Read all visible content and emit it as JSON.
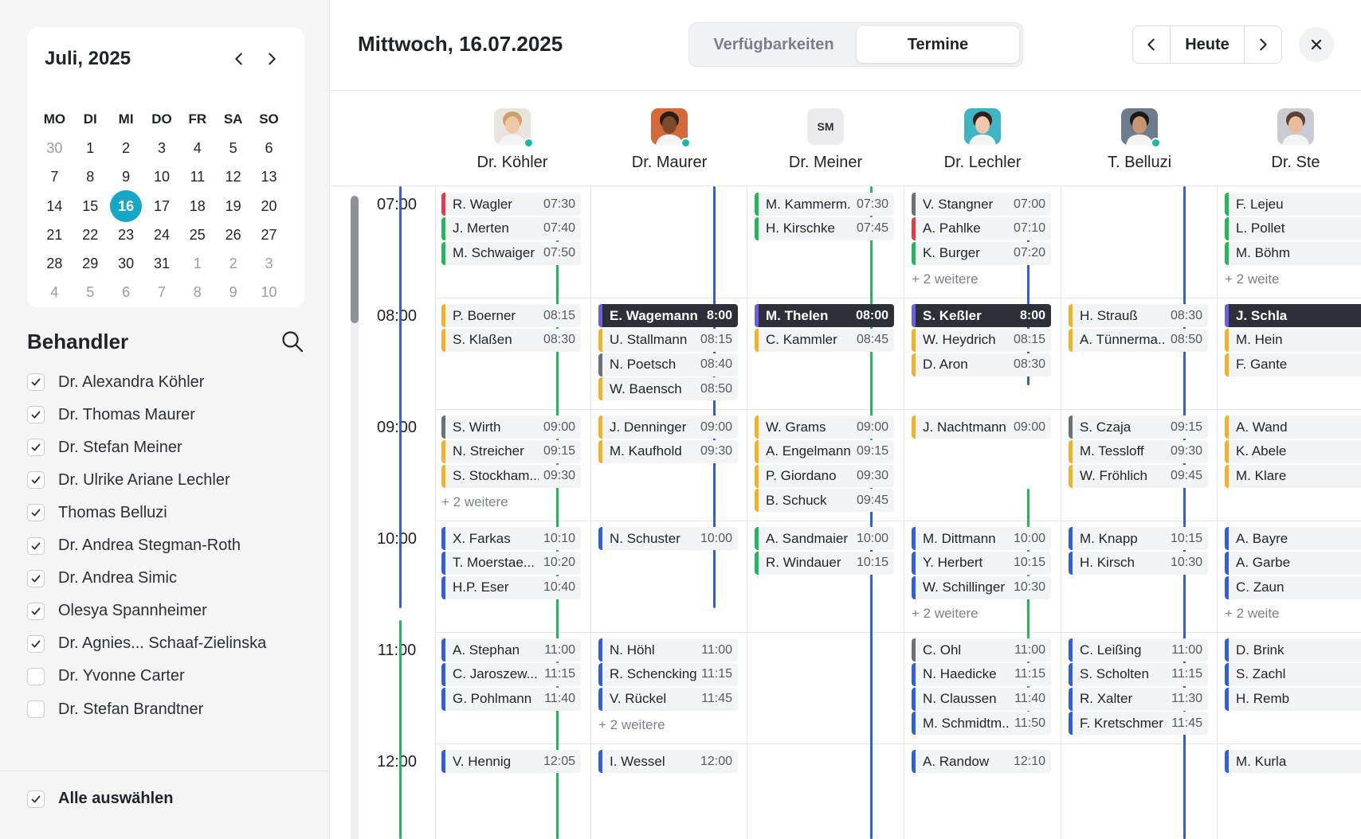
{
  "sidebar": {
    "month_title": "Juli, 2025",
    "weekdays": [
      "MO",
      "DI",
      "MI",
      "DO",
      "FR",
      "SA",
      "SO"
    ],
    "weeks": [
      [
        {
          "d": "30",
          "m": true
        },
        {
          "d": "1"
        },
        {
          "d": "2"
        },
        {
          "d": "3"
        },
        {
          "d": "4"
        },
        {
          "d": "5"
        },
        {
          "d": "6"
        }
      ],
      [
        {
          "d": "7"
        },
        {
          "d": "8"
        },
        {
          "d": "9"
        },
        {
          "d": "10"
        },
        {
          "d": "11"
        },
        {
          "d": "12"
        },
        {
          "d": "13"
        }
      ],
      [
        {
          "d": "14"
        },
        {
          "d": "15"
        },
        {
          "d": "16",
          "today": true
        },
        {
          "d": "17"
        },
        {
          "d": "18"
        },
        {
          "d": "19"
        },
        {
          "d": "20"
        }
      ],
      [
        {
          "d": "21"
        },
        {
          "d": "22"
        },
        {
          "d": "23"
        },
        {
          "d": "24"
        },
        {
          "d": "25"
        },
        {
          "d": "26"
        },
        {
          "d": "27"
        }
      ],
      [
        {
          "d": "28"
        },
        {
          "d": "29"
        },
        {
          "d": "30"
        },
        {
          "d": "31"
        },
        {
          "d": "1",
          "m": true
        },
        {
          "d": "2",
          "m": true
        },
        {
          "d": "3",
          "m": true
        }
      ],
      [
        {
          "d": "4",
          "m": true
        },
        {
          "d": "5",
          "m": true
        },
        {
          "d": "6",
          "m": true
        },
        {
          "d": "7",
          "m": true
        },
        {
          "d": "8",
          "m": true
        },
        {
          "d": "9",
          "m": true
        },
        {
          "d": "10",
          "m": true
        }
      ]
    ],
    "behandler_title": "Behandler",
    "behandler": [
      {
        "label": "Dr. Alexandra Köhler",
        "checked": true
      },
      {
        "label": "Dr. Thomas Maurer",
        "checked": true
      },
      {
        "label": "Dr. Stefan Meiner",
        "checked": true
      },
      {
        "label": " Dr. Ulrike Ariane Lechler",
        "checked": true
      },
      {
        "label": "Thomas Belluzi",
        "checked": true
      },
      {
        "label": "Dr. Andrea Stegman-Roth",
        "checked": true
      },
      {
        "label": "Dr. Andrea Simic",
        "checked": true
      },
      {
        "label": "Olesya Spannheimer",
        "checked": true
      },
      {
        "label": "Dr. Agnies... Schaaf-Zielinska",
        "checked": true
      },
      {
        "label": "Dr. Yvonne Carter",
        "checked": false
      },
      {
        "label": "Dr. Stefan Brandtner",
        "checked": false
      }
    ],
    "select_all_label": "Alle auswählen"
  },
  "header": {
    "date_title": "Mittwoch, 16.07.2025",
    "tabs": [
      "Verfügbarkeiten",
      "Termine"
    ],
    "active_tab": "Termine",
    "today_label": "Heute"
  },
  "colors": {
    "red": "#e53b46",
    "green": "#1fb95c",
    "yellow": "#f3b124",
    "gray": "#6b7079",
    "purple": "#6d5ce6",
    "blue": "#2f5fdc"
  },
  "doctors": [
    {
      "name": "Dr. Köhler",
      "avatar": "photo",
      "online": true
    },
    {
      "name": "Dr. Maurer",
      "avatar": "photo",
      "online": true
    },
    {
      "name": "Dr. Meiner",
      "avatar": "SM",
      "online": false
    },
    {
      "name": "Dr. Lechler",
      "avatar": "photo",
      "online": false
    },
    {
      "name": "T. Belluzi",
      "avatar": "photo",
      "online": true
    },
    {
      "name": "Dr. Ste",
      "avatar": "photo",
      "online": false
    }
  ],
  "hours": [
    "07:00",
    "08:00",
    "09:00",
    "10:00",
    "11:00",
    "12:00"
  ],
  "schedule": [
    [
      [
        [
          "R. Wagler",
          "07:30",
          "red"
        ],
        [
          "J. Merten",
          "07:40",
          "green"
        ],
        [
          "M. Schwaiger",
          "07:50",
          "green"
        ]
      ],
      [
        [
          "P. Boerner",
          "08:15",
          "yellow"
        ],
        [
          "S. Klaßen",
          "08:30",
          "yellow"
        ]
      ],
      [
        [
          "S. Wirth",
          "09:00",
          "gray"
        ],
        [
          "N. Streicher",
          "09:15",
          "yellow"
        ],
        [
          "S. Stockham...",
          "09:30",
          "yellow"
        ],
        "+ 2 weitere"
      ],
      [
        [
          "X. Farkas",
          "10:10",
          "blue"
        ],
        [
          "T. Moerstae...",
          "10:20",
          "blue"
        ],
        [
          "H.P. Eser",
          "10:40",
          "blue"
        ]
      ],
      [
        [
          "A. Stephan",
          "11:00",
          "blue"
        ],
        [
          "C. Jaroszew...",
          "11:15",
          "blue"
        ],
        [
          "G. Pohlmann",
          "11:40",
          "blue"
        ]
      ],
      [
        [
          "V. Hennig",
          "12:05",
          "blue"
        ]
      ]
    ],
    [
      [],
      [
        [
          "E. Wagemann",
          "8:00",
          "purple",
          "dark"
        ],
        [
          "U. Stallmann",
          "08:15",
          "yellow"
        ],
        [
          "N. Poetsch",
          "08:40",
          "gray"
        ],
        [
          "W. Baensch",
          "08:50",
          "yellow"
        ]
      ],
      [
        [
          "J. Denninger",
          "09:00",
          "yellow"
        ],
        [
          "M. Kaufhold",
          "09:30",
          "yellow"
        ]
      ],
      [
        [
          "N. Schuster",
          "10:00",
          "blue"
        ]
      ],
      [
        [
          "N. Höhl",
          "11:00",
          "blue"
        ],
        [
          "R. Schencking",
          "11:15",
          "blue"
        ],
        [
          "V. Rückel",
          "11:45",
          "blue"
        ],
        "+ 2 weitere"
      ],
      [
        [
          "I. Wessel",
          "12:00",
          "blue"
        ]
      ]
    ],
    [
      [
        [
          "M. Kammerm...",
          "07:30",
          "green"
        ],
        [
          "H. Kirschke",
          "07:45",
          "green"
        ]
      ],
      [
        [
          "M. Thelen",
          "08:00",
          "purple",
          "dark"
        ],
        [
          "C. Kammler",
          "08:45",
          "yellow"
        ]
      ],
      [
        [
          "W. Grams",
          "09:00",
          "yellow"
        ],
        [
          "A. Engelmann",
          "09:15",
          "yellow"
        ],
        [
          "P. Giordano",
          "09:30",
          "yellow"
        ],
        [
          "B. Schuck",
          "09:45",
          "yellow"
        ]
      ],
      [
        [
          "A. Sandmaier",
          "10:00",
          "green"
        ],
        [
          "R. Windauer",
          "10:15",
          "green"
        ]
      ],
      [],
      []
    ],
    [
      [
        [
          "V. Stangner",
          "07:00",
          "gray"
        ],
        [
          "A. Pahlke",
          "07:10",
          "red"
        ],
        [
          "K. Burger",
          "07:20",
          "green"
        ],
        "+ 2 weitere"
      ],
      [
        [
          "S. Keßler",
          "8:00",
          "purple",
          "dark"
        ],
        [
          "W. Heydrich",
          "08:15",
          "yellow"
        ],
        [
          "D. Aron",
          "08:30",
          "yellow"
        ]
      ],
      [
        [
          "J. Nachtmann",
          "09:00",
          "yellow"
        ]
      ],
      [
        [
          "M. Dittmann",
          "10:00",
          "blue"
        ],
        [
          "Y. Herbert",
          "10:15",
          "blue"
        ],
        [
          "W. Schillinger",
          "10:30",
          "blue"
        ],
        "+ 2 weitere"
      ],
      [
        [
          "C. Ohl",
          "11:00",
          "gray"
        ],
        [
          "N. Haedicke",
          "11:15",
          "blue"
        ],
        [
          "N. Claussen",
          "11:40",
          "blue"
        ],
        [
          "M. Schmidtm...",
          "11:50",
          "blue"
        ]
      ],
      [
        [
          "A. Randow",
          "12:10",
          "blue"
        ]
      ]
    ],
    [
      [],
      [
        [
          "H. Strauß",
          "08:30",
          "yellow"
        ],
        [
          "A. Tünnerma...",
          "08:50",
          "yellow"
        ]
      ],
      [
        [
          "S. Czaja",
          "09:15",
          "gray"
        ],
        [
          "M. Tessloff",
          "09:30",
          "yellow"
        ],
        [
          "W. Fröhlich",
          "09:45",
          "yellow"
        ]
      ],
      [
        [
          "M. Knapp",
          "10:15",
          "blue"
        ],
        [
          "H. Kirsch",
          "10:30",
          "blue"
        ]
      ],
      [
        [
          "C. Leißing",
          "11:00",
          "blue"
        ],
        [
          "S. Scholten",
          "11:15",
          "blue"
        ],
        [
          "R. Xalter",
          "11:30",
          "blue"
        ],
        [
          "F. Kretschmer",
          "11:45",
          "blue"
        ]
      ],
      []
    ],
    [
      [
        [
          "F. Lejeu",
          "",
          "green"
        ],
        [
          "L. Pollet",
          "",
          "green"
        ],
        [
          "M. Böhm",
          "",
          "green"
        ],
        "+ 2 weite"
      ],
      [
        [
          "J. Schla",
          "",
          "purple",
          "dark"
        ],
        [
          "M. Hein",
          "",
          "yellow"
        ],
        [
          "F. Gante",
          "",
          "yellow"
        ]
      ],
      [
        [
          "A. Wand",
          "",
          "yellow"
        ],
        [
          "K. Abele",
          "",
          "yellow"
        ],
        [
          "M. Klare",
          "",
          "yellow"
        ]
      ],
      [
        [
          "A. Bayre",
          "",
          "blue"
        ],
        [
          "A. Garbe",
          "",
          "blue"
        ],
        [
          "C. Zaun",
          "",
          "blue"
        ],
        "+ 2 weite"
      ],
      [
        [
          "D. Brink",
          "",
          "blue"
        ],
        [
          "S. Zachl",
          "",
          "blue"
        ],
        [
          "H. Remb",
          "",
          "blue"
        ]
      ],
      [
        [
          "M. Kurla",
          "",
          "blue"
        ]
      ]
    ]
  ]
}
